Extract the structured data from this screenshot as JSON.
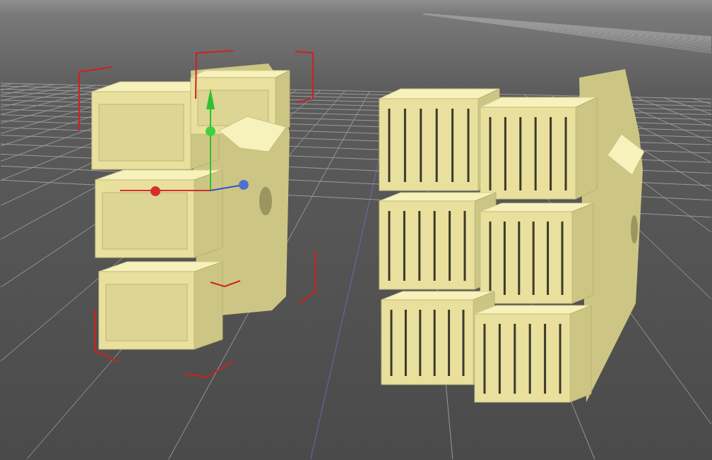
{
  "viewport": {
    "objects": [
      {
        "kind": "plain",
        "selected": true
      },
      {
        "kind": "slatted",
        "selected": false
      }
    ]
  }
}
